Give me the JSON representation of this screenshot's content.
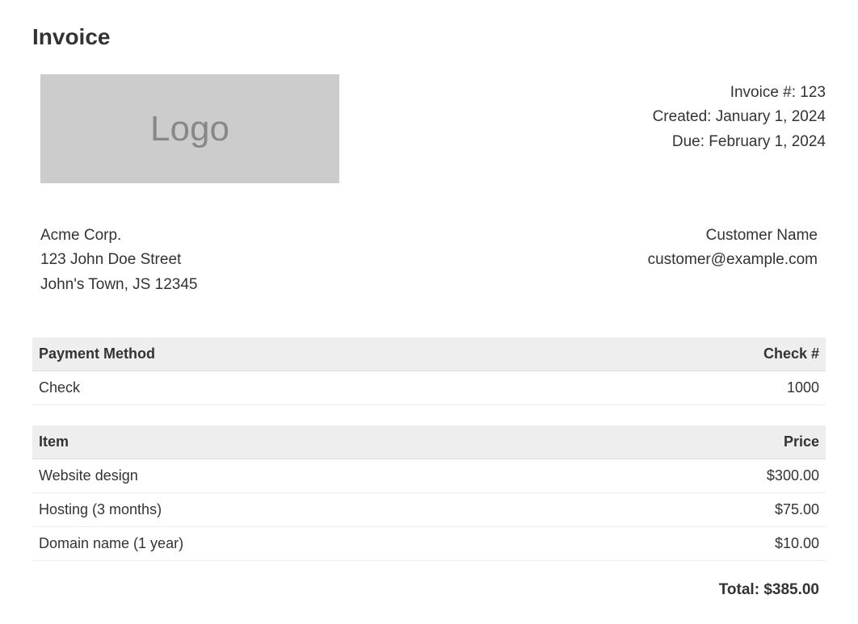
{
  "page_title": "Invoice",
  "logo_text": "Logo",
  "meta": {
    "invoice_number_label": "Invoice #: 123",
    "created_label": "Created: January 1, 2024",
    "due_label": "Due: February 1, 2024"
  },
  "company": {
    "name": "Acme Corp.",
    "street": "123 John Doe Street",
    "city_line": "John's Town, JS 12345"
  },
  "customer": {
    "name": "Customer Name",
    "email": "customer@example.com"
  },
  "payment_table": {
    "header_method": "Payment Method",
    "header_check": "Check #",
    "method": "Check",
    "check_number": "1000"
  },
  "items_table": {
    "header_item": "Item",
    "header_price": "Price",
    "rows": [
      {
        "item": "Website design",
        "price": "$300.00"
      },
      {
        "item": "Hosting (3 months)",
        "price": "$75.00"
      },
      {
        "item": "Domain name (1 year)",
        "price": "$10.00"
      }
    ]
  },
  "total_label": "Total: $385.00"
}
